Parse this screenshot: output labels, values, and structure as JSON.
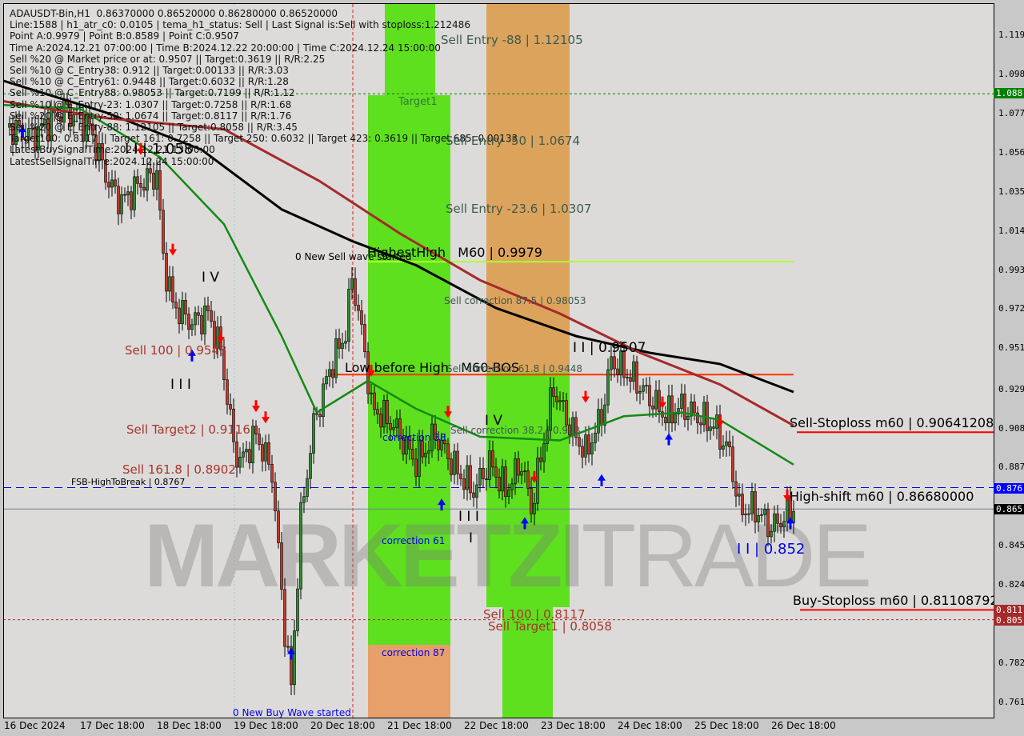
{
  "info": {
    "lines": [
      "ADAUSDT-Bin,H1  0.86370000 0.86520000 0.86280000 0.86520000",
      "Line:1588 | h1_atr_c0: 0.0105 | tema_h1_status: Sell | Last Signal is:Sell with stoploss:1.212486",
      "Point A:0.9979 | Point B:0.8589 | Point C:0.9507",
      "Time A:2024.12.21 07:00:00 | Time B:2024.12.22 20:00:00 | Time C:2024.12.24 15:00:00",
      "Sell %20 @ Market price or at: 0.9507 || Target:0.3619 || R/R:2.25",
      "Sell %10 @ C_Entry38: 0.912 || Target:0.00133 || R/R:3.03",
      "Sell %10 @ C_Entry61: 0.9448 || Target:0.6032 || R/R:1.28",
      "Sell %10 @ C_Entry88: 0.98053 || Target:0.7199 || R/R:1.12",
      "Sell %10 @ E_Entry-23: 1.0307 || Target:0.7258 || R/R:1.68",
      "Sell %20 @ E_Entry-50: 1.0674 || Target:0.8117 || R/R:1.76",
      "Sell %20 @ E_Entry-88: 1.12105 || Target:0.8058 || R/R:3.45",
      "Target100: 0.8117 || Target 161: 0.7258 || Target 250: 0.6032 || Target 423: 0.3619 || Target 685: 0.00133",
      "LatestBuySignalTime:2024.12.21 13:00:00",
      "LatestSellSignalTime:2024.12.24 15:00:00"
    ]
  },
  "labels": {
    "sell_entry_88": "Sell Entry -88 | 1.12105",
    "target1": "Target1",
    "sell_entry_50": "Sell Entry -50 | 1.0674",
    "sell_entry_236": "Sell Entry -23.6 | 1.0307",
    "highest_high": "HighestHigh   M60 | 0.9979",
    "new_sell_wave": "0 New Sell wave started",
    "sell_corr_875": "Sell correction 87.5 | 0.98053",
    "point_c": "I I | 0.9507",
    "low_before_high": "Low before High   M60-BOS",
    "sell_corr_618": "Sell correction 61.8 | 0.9448",
    "sell_100_left": "Sell 100 | 0.9543",
    "wave_iii": "I I I",
    "sell_target2": "Sell Target2 | 0.9116",
    "correction_38": "correction 38",
    "sell_corr_382": "Sell correction 38.2 | 0.912",
    "wave_iv_mid": "I V",
    "wave_iv_left": "I V",
    "sell_1618": "Sell 161.8 | 0.8902",
    "fsb": "FSB-HighToBreak | 0.8767",
    "wave_iii_mid": "I I I",
    "wave_i_mid": "I",
    "correction_61": "correction 61",
    "sell_stoploss": "Sell-Stoploss m60 | 0.90641208",
    "high_shift": "High-shift m60 | 0.86680000",
    "point_b_low": "I I | 0.852",
    "buy_stoploss": "Buy-Stoploss m60 | 0.81108792",
    "sell_100_mid": "Sell 100 | 0.8117",
    "sell_target1": "Sell Target1 | 0.8058",
    "correction_87": "correction 87",
    "new_buy_wave": "0 New Buy Wave started",
    "wave_ii_top": "I I | 1.058"
  },
  "logo": "MARKETZITRADE",
  "colors": {
    "bg": "#dcdbd9",
    "green_zone": "#5ee01e",
    "orange_zone": "#e8a06a",
    "black_ma": "#000000",
    "brown_ma": "#a52a2a",
    "green_ma": "#138a13",
    "sell": "#ff0000",
    "buy": "#0000ff"
  },
  "chart_data": {
    "type": "candlestick",
    "symbol": "ADAUSDT-Bin",
    "timeframe": "H1",
    "ylim": [
      0.755,
      1.135
    ],
    "y_ticks": [
      "1.119",
      "1.098",
      "1.077",
      "1.056",
      "1.035",
      "1.014",
      "0.993",
      "0.972",
      "0.951",
      "0.929",
      "0.908",
      "0.887",
      "0.845",
      "0.824",
      "0.782",
      "0.761"
    ],
    "x_ticks": [
      "16 Dec 2024",
      "17 Dec 18:00",
      "18 Dec 18:00",
      "19 Dec 18:00",
      "20 Dec 18:00",
      "21 Dec 18:00",
      "22 Dec 18:00",
      "23 Dec 18:00",
      "24 Dec 18:00",
      "25 Dec 18:00",
      "26 Dec 18:00"
    ],
    "price_badges": [
      {
        "value": "1.088",
        "color": "#008000"
      },
      {
        "value": "0.876",
        "color": "#0000ff"
      },
      {
        "value": "0.865",
        "color": "#000000"
      },
      {
        "value": "0.811",
        "color": "#a52a2a"
      },
      {
        "value": "0.805",
        "color": "#a52a2a"
      }
    ],
    "close_path": [
      [
        "2024-12-16 20:00",
        1.07
      ],
      [
        "2024-12-17 03:00",
        1.065
      ],
      [
        "2024-12-17 13:00",
        1.08
      ],
      [
        "2024-12-17 21:00",
        1.07
      ],
      [
        "2024-12-18 03:00",
        1.04
      ],
      [
        "2024-12-18 07:00",
        1.03
      ],
      [
        "2024-12-18 13:00",
        1.04
      ],
      [
        "2024-12-18 18:00",
        1.045
      ],
      [
        "2024-12-18 20:00",
        1.0
      ],
      [
        "2024-12-18 23:00",
        0.975
      ],
      [
        "2024-12-19 05:00",
        0.965
      ],
      [
        "2024-12-19 10:00",
        0.97
      ],
      [
        "2024-12-19 14:00",
        0.95
      ],
      [
        "2024-12-19 18:00",
        0.9
      ],
      [
        "2024-12-19 20:00",
        0.89
      ],
      [
        "2024-12-20 01:00",
        0.905
      ],
      [
        "2024-12-20 06:00",
        0.885
      ],
      [
        "2024-12-20 10:00",
        0.8
      ],
      [
        "2024-12-20 12:00",
        0.77
      ],
      [
        "2024-12-20 15:00",
        0.86
      ],
      [
        "2024-12-20 19:00",
        0.91
      ],
      [
        "2024-12-21 00:00",
        0.94
      ],
      [
        "2024-12-21 05:00",
        0.96
      ],
      [
        "2024-12-21 07:00",
        0.99
      ],
      [
        "2024-12-21 11:00",
        0.95
      ],
      [
        "2024-12-21 13:00",
        0.92
      ],
      [
        "2024-12-21 20:00",
        0.91
      ],
      [
        "2024-12-22 03:00",
        0.89
      ],
      [
        "2024-12-22 09:00",
        0.905
      ],
      [
        "2024-12-22 16:00",
        0.885
      ],
      [
        "2024-12-22 21:00",
        0.875
      ],
      [
        "2024-12-23 02:00",
        0.89
      ],
      [
        "2024-12-23 07:00",
        0.875
      ],
      [
        "2024-12-23 12:00",
        0.89
      ],
      [
        "2024-12-23 15:00",
        0.865
      ],
      [
        "2024-12-23 22:00",
        0.93
      ],
      [
        "2024-12-24 03:00",
        0.91
      ],
      [
        "2024-12-24 08:00",
        0.895
      ],
      [
        "2024-12-24 13:00",
        0.915
      ],
      [
        "2024-12-24 16:00",
        0.945
      ],
      [
        "2024-12-24 23:00",
        0.935
      ],
      [
        "2024-12-25 04:00",
        0.925
      ],
      [
        "2024-12-25 09:00",
        0.915
      ],
      [
        "2024-12-25 14:00",
        0.92
      ],
      [
        "2024-12-25 19:00",
        0.915
      ],
      [
        "2024-12-26 00:00",
        0.91
      ],
      [
        "2024-12-26 05:00",
        0.895
      ],
      [
        "2024-12-26 08:00",
        0.865
      ],
      [
        "2024-12-26 13:00",
        0.865
      ],
      [
        "2024-12-26 18:00",
        0.855
      ],
      [
        "2024-12-27 01:00",
        0.8652
      ]
    ],
    "ma_black": [
      [
        "2024-12-16 18:00",
        1.095
      ],
      [
        "2024-12-18 02:00",
        1.078
      ],
      [
        "2024-12-19 08:00",
        1.058
      ],
      [
        "2024-12-20 09:00",
        1.026
      ],
      [
        "2024-12-21 07:00",
        1.009
      ],
      [
        "2024-12-22 03:00",
        0.996
      ],
      [
        "2024-12-23 04:00",
        0.973
      ],
      [
        "2024-12-24 05:00",
        0.958
      ],
      [
        "2024-12-25 04:00",
        0.949
      ],
      [
        "2024-12-26 02:00",
        0.943
      ],
      [
        "2024-12-27 01:00",
        0.928
      ]
    ],
    "ma_brown": [
      [
        "2024-12-16 18:00",
        1.084
      ],
      [
        "2024-12-18 02:00",
        1.075
      ],
      [
        "2024-12-19 15:00",
        1.069
      ],
      [
        "2024-12-20 21:00",
        1.041
      ],
      [
        "2024-12-21 22:00",
        1.013
      ],
      [
        "2024-12-22 23:00",
        0.988
      ],
      [
        "2024-12-24 00:00",
        0.97
      ],
      [
        "2024-12-25 01:00",
        0.949
      ],
      [
        "2024-12-26 02:00",
        0.932
      ],
      [
        "2024-12-27 01:00",
        0.91
      ]
    ],
    "ma_green": [
      [
        "2024-12-16 18:00",
        1.082
      ],
      [
        "2024-12-17 18:00",
        1.08
      ],
      [
        "2024-12-18 19:00",
        1.054
      ],
      [
        "2024-12-19 15:00",
        1.018
      ],
      [
        "2024-12-20 09:00",
        0.958
      ],
      [
        "2024-12-20 20:00",
        0.917
      ],
      [
        "2024-12-21 12:00",
        0.934
      ],
      [
        "2024-12-22 03:00",
        0.919
      ],
      [
        "2024-12-22 23:00",
        0.904
      ],
      [
        "2024-12-24 00:00",
        0.902
      ],
      [
        "2024-12-24 20:00",
        0.915
      ],
      [
        "2024-12-25 14:00",
        0.917
      ],
      [
        "2024-12-26 02:00",
        0.913
      ],
      [
        "2024-12-27 01:00",
        0.889
      ]
    ],
    "levels": [
      {
        "name": "target1",
        "price": 1.088,
        "color": "#008000",
        "style": "dotted",
        "from": "2024-12-16 18:00"
      },
      {
        "name": "highest-high",
        "price": 0.9979,
        "color": "#adff2f",
        "style": "solid",
        "from": "2024-12-21 12:00",
        "to": "2024-12-27 01:00"
      },
      {
        "name": "low-before-high",
        "price": 0.9373,
        "color": "#ff3300",
        "style": "solid",
        "from": "2024-12-21 00:00",
        "to": "2024-12-27 01:00"
      },
      {
        "name": "sell-stoploss",
        "price": 0.9064,
        "color": "#ff0000",
        "style": "solid",
        "from": "2024-12-27 02:00"
      },
      {
        "name": "fsb-high-to-break",
        "price": 0.8767,
        "color": "#0000ff",
        "style": "dashed",
        "from": "2024-12-16 18:00"
      },
      {
        "name": "current-price",
        "price": 0.8652,
        "color": "#708090",
        "style": "solid",
        "from": "2024-12-16 18:00"
      },
      {
        "name": "buy-stoploss",
        "price": 0.81108,
        "color": "#ff0000",
        "style": "solid",
        "from": "2024-12-27 03:00"
      },
      {
        "name": "sell-target1",
        "price": 0.8058,
        "color": "#a52a2a",
        "style": "dotted",
        "from": "2024-12-16 18:00"
      }
    ],
    "signals": [
      {
        "t": "2024-12-17 00:00",
        "p": 1.07,
        "type": "buy"
      },
      {
        "t": "2024-12-18 13:00",
        "p": 1.056,
        "type": "sell"
      },
      {
        "t": "2024-12-18 23:00",
        "p": 1.002,
        "type": "sell"
      },
      {
        "t": "2024-12-19 05:00",
        "p": 0.95,
        "type": "buy"
      },
      {
        "t": "2024-12-19 14:00",
        "p": 0.955,
        "type": "sell"
      },
      {
        "t": "2024-12-20 01:00",
        "p": 0.918,
        "type": "sell"
      },
      {
        "t": "2024-12-20 04:00",
        "p": 0.912,
        "type": "sell"
      },
      {
        "t": "2024-12-20 12:00",
        "p": 0.79,
        "type": "buy"
      },
      {
        "t": "2024-12-21 13:00",
        "p": 0.937,
        "type": "sell"
      },
      {
        "t": "2024-12-22 13:00",
        "p": 0.915,
        "type": "sell"
      },
      {
        "t": "2024-12-22 11:00",
        "p": 0.87,
        "type": "buy"
      },
      {
        "t": "2024-12-23 13:00",
        "p": 0.86,
        "type": "buy"
      },
      {
        "t": "2024-12-23 16:00",
        "p": 0.88,
        "type": "sell"
      },
      {
        "t": "2024-12-24 08:00",
        "p": 0.923,
        "type": "sell"
      },
      {
        "t": "2024-12-24 13:00",
        "p": 0.883,
        "type": "buy"
      },
      {
        "t": "2024-12-25 08:00",
        "p": 0.92,
        "type": "sell"
      },
      {
        "t": "2024-12-25 10:00",
        "p": 0.905,
        "type": "buy"
      },
      {
        "t": "2024-12-26 02:00",
        "p": 0.91,
        "type": "sell"
      },
      {
        "t": "2024-12-27 00:00",
        "p": 0.86,
        "type": "buy"
      },
      {
        "t": "2024-12-26 23:00",
        "p": 0.87,
        "type": "sell"
      }
    ]
  }
}
